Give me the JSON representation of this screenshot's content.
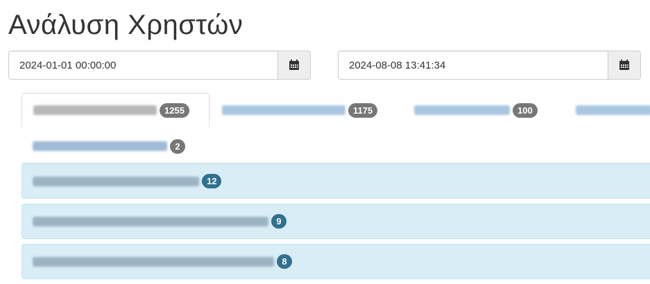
{
  "page": {
    "title": "Ανάλυση Χρηστών"
  },
  "date_range": {
    "start": "2024-01-01 00:00:00",
    "end": "2024-08-08 13:41:34",
    "calendar_icon": "calendar-icon"
  },
  "tabs": [
    {
      "count": "1255",
      "active": true
    },
    {
      "count": "1175",
      "active": false
    },
    {
      "count": "100",
      "active": false
    },
    {
      "count": "",
      "active": false
    },
    {
      "count": "2",
      "active": false
    }
  ],
  "list": [
    {
      "count": "12"
    },
    {
      "count": "9"
    },
    {
      "count": "8"
    }
  ],
  "colors": {
    "accent": "#337ab7",
    "badge_grey": "#777777",
    "badge_info": "#31708f",
    "info_bg": "#d9edf7"
  }
}
